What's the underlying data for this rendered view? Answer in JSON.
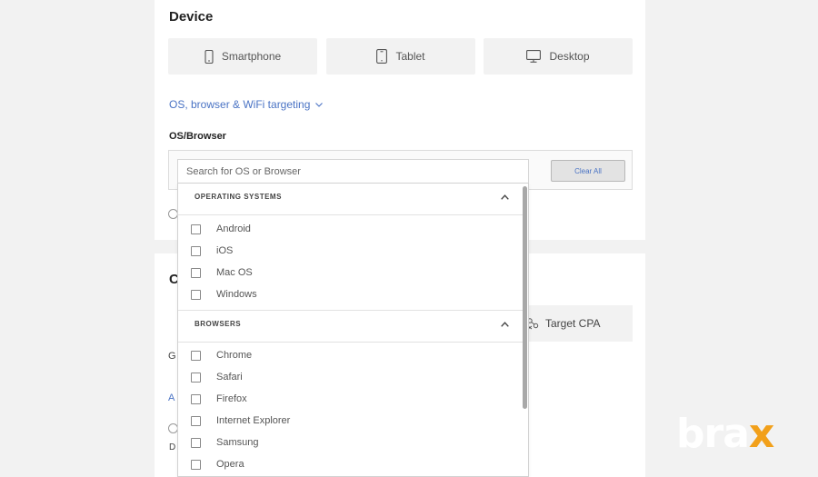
{
  "device_section": {
    "title": "Device",
    "buttons": [
      {
        "label": "Smartphone",
        "icon": "smartphone-icon"
      },
      {
        "label": "Tablet",
        "icon": "tablet-icon"
      },
      {
        "label": "Desktop",
        "icon": "desktop-icon"
      }
    ],
    "targeting_link": "OS, browser & WiFi targeting",
    "os_browser_label": "OS/Browser",
    "search_placeholder": "Search for OS or Browser",
    "clear_all": "Clear All"
  },
  "bottom_section": {
    "title_partial": "C",
    "target_cpa": "Target CPA",
    "partial_text_1": "G",
    "partial_link": "A",
    "partial_text_2": "D"
  },
  "dropdown": {
    "groups": [
      {
        "header": "OPERATING SYSTEMS",
        "options": [
          "Android",
          "iOS",
          "Mac OS",
          "Windows"
        ]
      },
      {
        "header": "BROWSERS",
        "options": [
          "Chrome",
          "Safari",
          "Firefox",
          "Internet Explorer",
          "Samsung",
          "Opera"
        ]
      }
    ]
  },
  "watermark": {
    "text": "bra",
    "accent": "x",
    "accent_color": "#f2a01a"
  },
  "colors": {
    "link": "#4a73c4",
    "background": "#f2f2f2",
    "card": "#ffffff"
  }
}
